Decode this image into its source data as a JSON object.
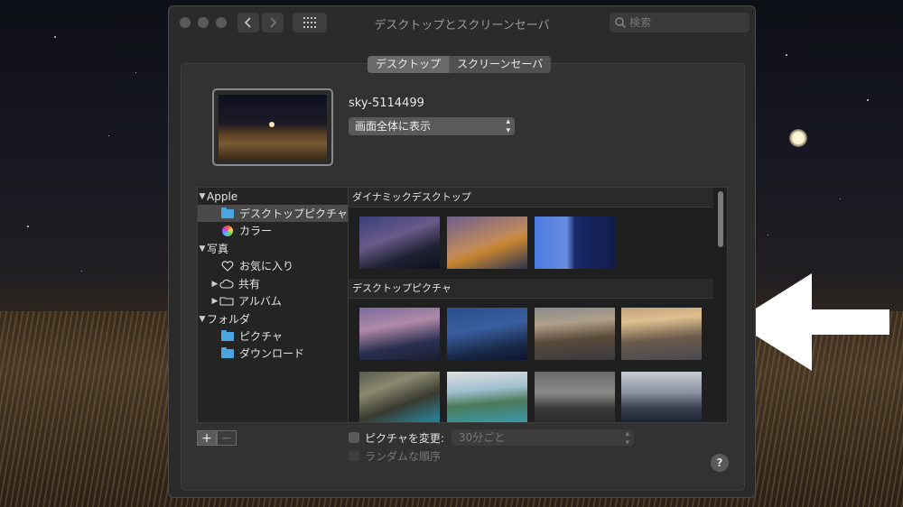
{
  "window": {
    "title": "デスクトップとスクリーンセーバ"
  },
  "search": {
    "placeholder": "検索"
  },
  "tabs": [
    {
      "label": "デスクトップ",
      "active": true
    },
    {
      "label": "スクリーンセーバ",
      "active": false
    }
  ],
  "wallpaper": {
    "name": "sky-5114499",
    "display_mode": "画面全体に表示"
  },
  "sidebar": {
    "apple": {
      "label": "Apple",
      "items": {
        "desktop_pictures": "デスクトップピクチャ",
        "colors": "カラー"
      }
    },
    "photos": {
      "label": "写真",
      "items": {
        "favorites": "お気に入り",
        "shared": "共有",
        "albums": "アルバム"
      }
    },
    "folders": {
      "label": "フォルダ",
      "items": {
        "pictures": "ピクチャ",
        "downloads": "ダウンロード"
      }
    }
  },
  "sections": {
    "dynamic": "ダイナミックデスクトップ",
    "desktop": "デスクトップピクチャ"
  },
  "bottom": {
    "add": "+",
    "remove": "−",
    "change_picture_label": "ピクチャを変更:",
    "interval": "30分ごと",
    "random_order_label": "ランダムな順序",
    "help": "?"
  }
}
